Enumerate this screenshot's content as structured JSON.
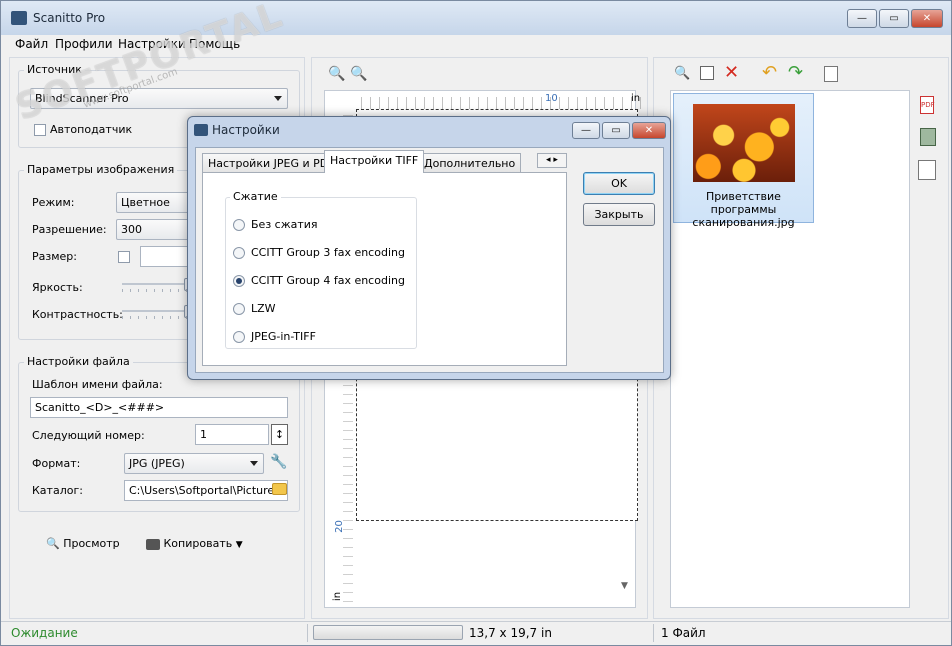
{
  "app": {
    "title": "Scanitto Pro"
  },
  "window_buttons": {
    "minimize": "—",
    "maximize": "▭",
    "close": "✕"
  },
  "menu": [
    "Файл",
    "Профили",
    "Настройки",
    "Помощь"
  ],
  "watermark": {
    "text": "SOFTPORTAL",
    "url": "www.softportal.com"
  },
  "source": {
    "group_label": "Источник",
    "scanner": "BlindScanner Pro",
    "autofeeder_label": "Автоподатчик"
  },
  "image_params": {
    "group_label": "Параметры изображения",
    "mode_label": "Режим:",
    "mode_value": "Цветное",
    "resolution_label": "Разрешение:",
    "resolution_value": "300",
    "size_label": "Размер:",
    "brightness_label": "Яркость:",
    "contrast_label": "Контрастность:"
  },
  "file_settings": {
    "group_label": "Настройки файла",
    "template_label": "Шаблон имени файла:",
    "template_value": "Scanitto_<D>_<###>",
    "next_number_label": "Следующий номер:",
    "next_number_value": "1",
    "format_label": "Формат:",
    "format_value": "JPG (JPEG)",
    "folder_label": "Каталог:",
    "folder_value": "C:\\Users\\Softportal\\Pictures\\Sc"
  },
  "actions": {
    "preview": "Просмотр",
    "copy": "Копировать"
  },
  "ruler": {
    "mark_10": "10",
    "unit_top": "in",
    "mark_20": "20",
    "unit_left": "in"
  },
  "thumbnails": [
    {
      "caption": "Приветствие программы сканирования.jpg"
    }
  ],
  "status": {
    "state": "Ожидание",
    "dimensions": "13,7 x 19,7 in",
    "file_count": "1 Файл"
  },
  "dialog": {
    "title": "Настройки",
    "tabs": [
      "Настройки JPEG и PDF",
      "Настройки TIFF",
      "Дополнительно"
    ],
    "active_tab": "Настройки TIFF",
    "compression_label": "Сжатие",
    "options": [
      "Без сжатия",
      "CCITT Group 3 fax encoding",
      "CCITT Group 4 fax encoding",
      "LZW",
      "JPEG-in-TIFF"
    ],
    "selected_option": "CCITT Group 4 fax encoding",
    "ok": "OK",
    "close": "Закрыть"
  },
  "colors": {
    "status_ok": "#2e8b2e",
    "accent_blue": "#3a77c0"
  }
}
